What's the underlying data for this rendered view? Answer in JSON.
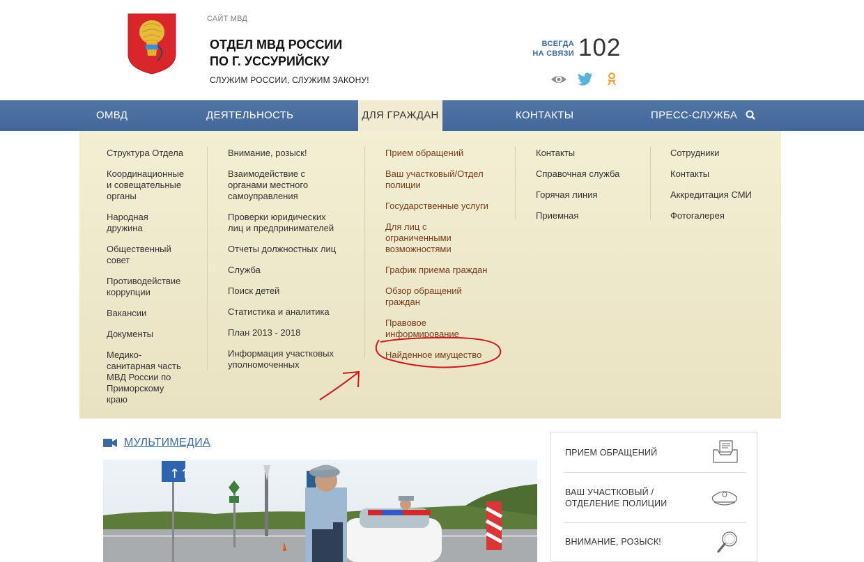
{
  "header": {
    "site_caption": "САЙТ МВД",
    "title_line1": "ОТДЕЛ МВД РОССИИ",
    "title_line2": "ПО Г. УССУРИЙСКУ",
    "slogan": "СЛУЖИМ РОССИИ, СЛУЖИМ ЗАКОНУ!",
    "always_line1": "ВСЕГДА",
    "always_line2": "НА СВЯЗИ",
    "phone": "102",
    "social_icons": [
      "eye-icon",
      "twitter-icon",
      "odnoklassniki-icon"
    ]
  },
  "nav": {
    "items": [
      {
        "label": "ОМВД"
      },
      {
        "label": "ДЕЯТЕЛЬНОСТЬ"
      },
      {
        "label": "ДЛЯ ГРАЖДАН"
      },
      {
        "label": "КОНТАКТЫ"
      },
      {
        "label": "ПРЕСС-СЛУЖБА"
      }
    ],
    "active": "ДЛЯ ГРАЖДАН"
  },
  "dropdown": {
    "columns": [
      {
        "links": [
          "Структура Отдела",
          "Координационные\nи совещательные\nорганы",
          "Народная\nдружина",
          "Общественный\nсовет",
          "Противодействие\nкоррупции",
          "Вакансии",
          "Документы",
          "Медико-\nсанитарная часть\nМВД России по\nПриморскому\nкраю"
        ]
      },
      {
        "links": [
          "Внимание, розыск!",
          "Взаимодействие с\nорганами местного\nсамоуправления",
          "Проверки юридических\nлиц и предпринимателей",
          "Отчеты должностных лиц",
          "Служба",
          "Поиск детей",
          "Статистика и аналитика",
          "План 2013 - 2018",
          "Информация участковых\nуполномоченных"
        ]
      },
      {
        "links": [
          "Прием обращений",
          "Ваш участковый/Отдел\nполиции",
          "Государственные услуги",
          "Для лиц с\nограниченными\nвозможностями",
          "График приема граждан",
          "Обзор обращений\nграждан",
          "Правовое\nинформирование",
          "Найденное имущество"
        ]
      },
      {
        "links": [
          "Контакты",
          "Справочная служба",
          "Горячая линия",
          "Приемная"
        ]
      },
      {
        "links": [
          "Сотрудники",
          "Контакты",
          "Аккредитация СМИ",
          "Фотогалерея"
        ]
      }
    ],
    "annotation_color": "#d0181d"
  },
  "multimedia": {
    "title": "МУЛЬТИМЕДИА"
  },
  "panel": {
    "items": [
      {
        "label": "ПРИЕМ ОБРАЩЕНИЙ",
        "icon": "mail-tray-icon"
      },
      {
        "label": "ВАШ УЧАСТКОВЫЙ /\nОТДЕЛЕНИЕ ПОЛИЦИИ",
        "icon": "police-cap-icon"
      },
      {
        "label": "ВНИМАНИЕ, РОЗЫСК!",
        "icon": "magnifier-icon"
      }
    ]
  },
  "colors": {
    "nav_bg": "#4a6fa0",
    "dropdown_bg": "#f1ecd1",
    "accent_blue": "#3c6a9e",
    "link_brown": "#7a3a1c"
  }
}
